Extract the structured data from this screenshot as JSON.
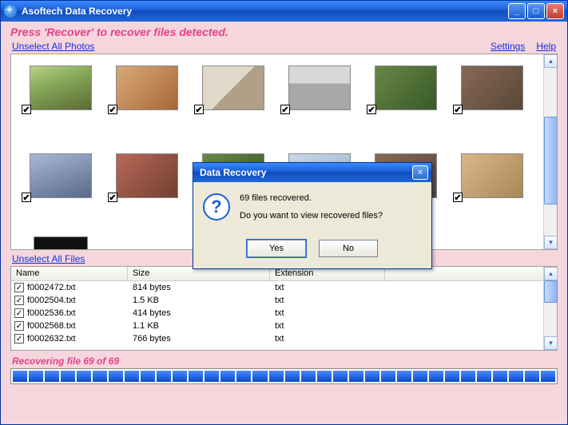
{
  "window": {
    "title": "Asoftech Data Recovery"
  },
  "instruction": "Press 'Recover' to recover files detected.",
  "links": {
    "unselect_photos": "Unselect All Photos",
    "unselect_files": "Unselect All Files",
    "settings": "Settings",
    "help": "Help"
  },
  "photos": {
    "checked_glyph": "✔",
    "count_visible": 13
  },
  "files": {
    "columns": {
      "name": "Name",
      "size": "Size",
      "ext": "Extension"
    },
    "rows": [
      {
        "name": "f0002472.txt",
        "size": "814 bytes",
        "ext": "txt",
        "checked": true
      },
      {
        "name": "f0002504.txt",
        "size": "1.5 KB",
        "ext": "txt",
        "checked": true
      },
      {
        "name": "f0002536.txt",
        "size": "414 bytes",
        "ext": "txt",
        "checked": true
      },
      {
        "name": "f0002568.txt",
        "size": "1.1 KB",
        "ext": "txt",
        "checked": true
      },
      {
        "name": "f0002632.txt",
        "size": "766 bytes",
        "ext": "txt",
        "checked": true
      }
    ]
  },
  "status": "Recovering file 69 of 69",
  "progress": {
    "blocks": 34,
    "percent": 100
  },
  "dialog": {
    "title": "Data Recovery",
    "line1": "69 files recovered.",
    "line2": "Do you want to view recovered files?",
    "yes": "Yes",
    "no": "No",
    "icon_glyph": "?"
  }
}
